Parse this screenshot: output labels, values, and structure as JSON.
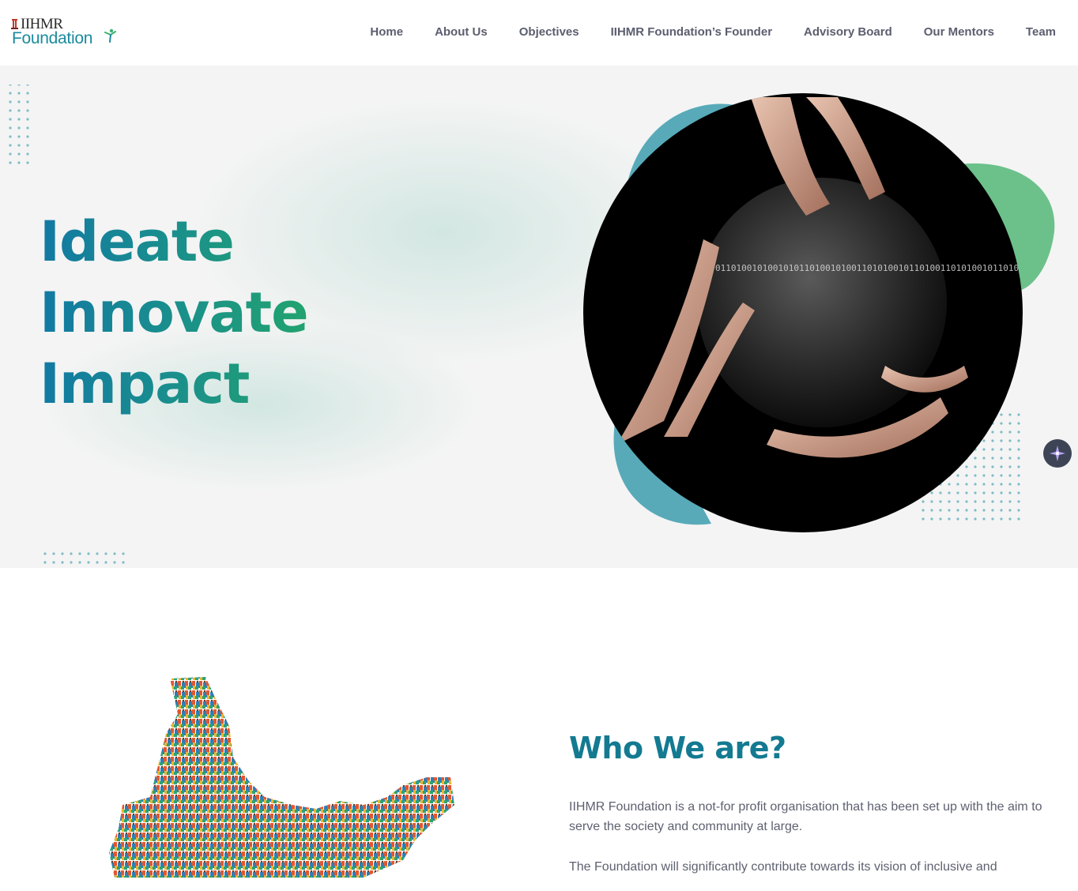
{
  "header": {
    "logo_top": "IIHMR",
    "logo_bottom": "Foundation",
    "nav": [
      "Home",
      "About Us",
      "Objectives",
      "IIHMR Foundation’s Founder",
      "Advisory Board",
      "Our Mentors",
      "Team"
    ]
  },
  "hero": {
    "lines": [
      "Ideate",
      "Innovate",
      "Impact"
    ],
    "binary_text": "0110100101001010110100101001101010010110100110101001011010",
    "ai_button_icon": "sparkle-icon"
  },
  "who": {
    "title": "Who We are?",
    "paragraphs": [
      "IIHMR Foundation is a not-for profit organisation that has been set up with the aim to serve the society and community at large.",
      "The Foundation will significantly contribute towards its vision of inclusive and"
    ]
  },
  "colors": {
    "teal": "#137a91",
    "green": "#22a36f",
    "nav_text": "#5b5e6e",
    "body_text": "#5e6170",
    "hero_bg": "#f4f4f4"
  }
}
